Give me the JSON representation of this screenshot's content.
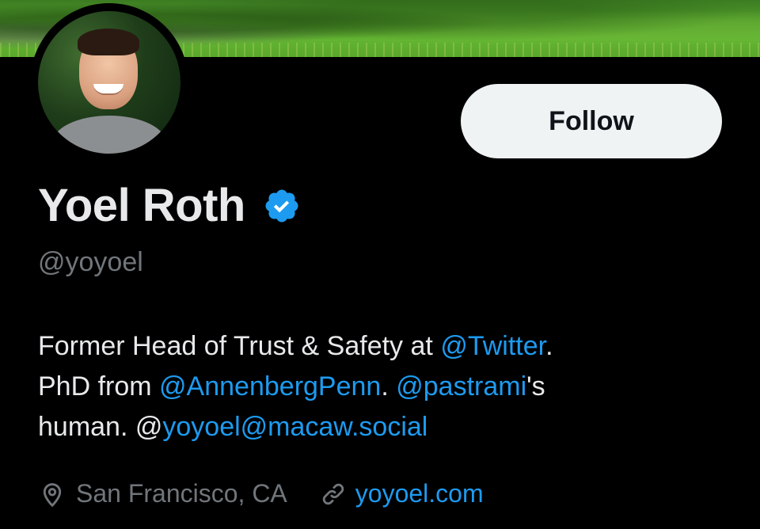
{
  "profile": {
    "name": "Yoel Roth",
    "verified": true,
    "handle": "@yoyoel",
    "follow_label": "Follow",
    "bio": {
      "line1_text": "Former Head of Trust & Safety at ",
      "line1_link": "@Twitter",
      "line1_end": ".",
      "line2_text": "PhD from ",
      "line2_link1": "@AnnenbergPenn",
      "line2_mid": ". ",
      "line2_link2": "@pastrami",
      "line2_end": "'s",
      "line3_text": "human. @",
      "line3_link": "yoyoel@macaw.social"
    },
    "location": "San Francisco, CA",
    "website": "yoyoel.com"
  },
  "icons": {
    "verified": "verified-badge-icon",
    "location": "location-pin-icon",
    "link": "link-icon"
  },
  "colors": {
    "background": "#000000",
    "text": "#e7e9ea",
    "muted": "#71767b",
    "link": "#1d9bf0",
    "button_bg": "#eff3f4"
  }
}
